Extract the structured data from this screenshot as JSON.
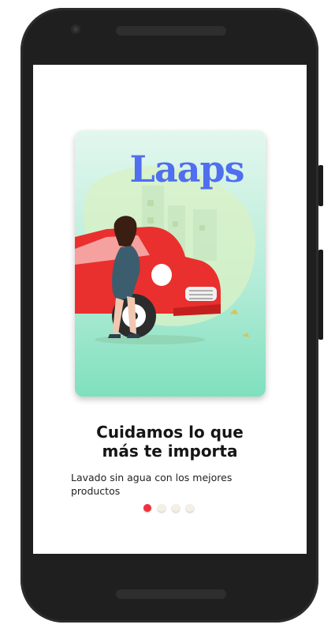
{
  "onboarding": {
    "brand": "Laaps",
    "title_line1": "Cuidamos lo que",
    "title_line2": "más te importa",
    "subtitle": "Lavado sin agua con los mejores productos",
    "pager": {
      "total": 4,
      "active_index": 0
    }
  },
  "colors": {
    "brand": "#4f6ef0",
    "accent_red": "#f0323c",
    "card_mint": "#7fe0be",
    "car_red": "#e9302e"
  },
  "icons": [
    "car-illustration",
    "woman-illustration"
  ]
}
